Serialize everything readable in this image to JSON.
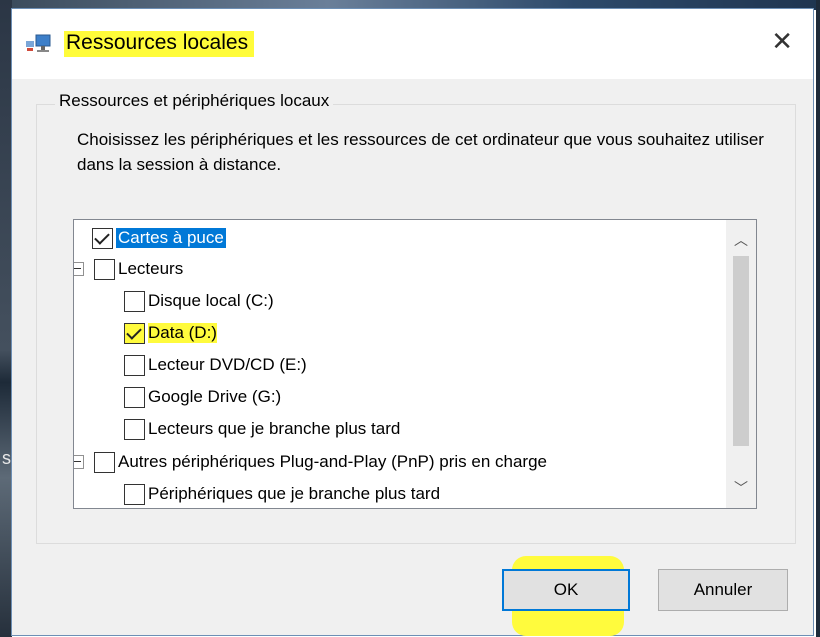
{
  "dialog": {
    "title": "Ressources locales",
    "close_icon": "close-icon",
    "app_icon": "remote-desktop-icon"
  },
  "group": {
    "legend": "Ressources et périphériques locaux",
    "description": "Choisissez les périphériques et les ressources de cet ordinateur que vous souhaitez utiliser dans la session à distance."
  },
  "tree": {
    "items": [
      {
        "label": "Cartes à puce",
        "checked": true,
        "selected": true
      },
      {
        "label": "Lecteurs",
        "checked": false,
        "expandable": true
      },
      {
        "label": "Disque local (C:)",
        "checked": false
      },
      {
        "label": "Data (D:)",
        "checked": true
      },
      {
        "label": "Lecteur DVD/CD (E:)",
        "checked": false
      },
      {
        "label": "Google Drive (G:)",
        "checked": false
      },
      {
        "label": "Lecteurs que je branche plus tard",
        "checked": false
      },
      {
        "label": "Autres périphériques Plug-and-Play (PnP) pris en charge",
        "checked": false,
        "expandable": true
      },
      {
        "label": "Périphériques que je branche plus tard",
        "checked": false
      }
    ]
  },
  "buttons": {
    "ok": "OK",
    "cancel": "Annuler"
  },
  "highlight_color": "#fffb3d",
  "accent_color": "#0078d7"
}
